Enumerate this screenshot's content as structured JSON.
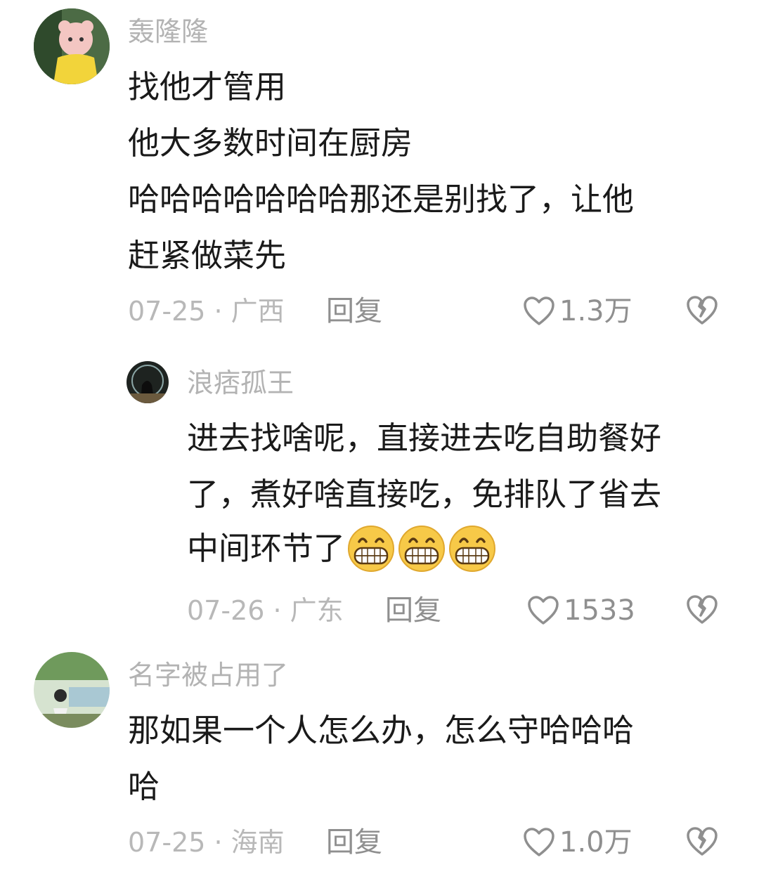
{
  "comments": [
    {
      "username": "轰隆隆",
      "lines": [
        "找他才管用",
        "他大多数时间在厨房",
        "哈哈哈哈哈哈哈那还是别找了，让他",
        "赶紧做菜先"
      ],
      "meta": "07-25 · 广西",
      "reply_label": "回复",
      "likes": "1.3万"
    },
    {
      "username": "浪痞孤王",
      "lines": [
        "进去找啥呢，直接进去吃自助餐好",
        "了，煮好啥直接吃，免排队了省去",
        "中间环节了"
      ],
      "emoji_count": 3,
      "meta": "07-26 · 广东",
      "reply_label": "回复",
      "likes": "1533"
    },
    {
      "username": "名字被占用了",
      "lines": [
        "那如果一个人怎么办，怎么守哈哈哈",
        "哈"
      ],
      "meta": "07-25 · 海南",
      "reply_label": "回复",
      "likes": "1.0万"
    }
  ],
  "icons": {
    "like": "heart-outline-icon",
    "dislike": "broken-heart-icon",
    "emoji": "grinning-face-emoji"
  },
  "colors": {
    "username": "#b3b3b3",
    "body": "#1a1a1a",
    "meta": "#b8b8b8",
    "action": "#8f8f8f"
  }
}
